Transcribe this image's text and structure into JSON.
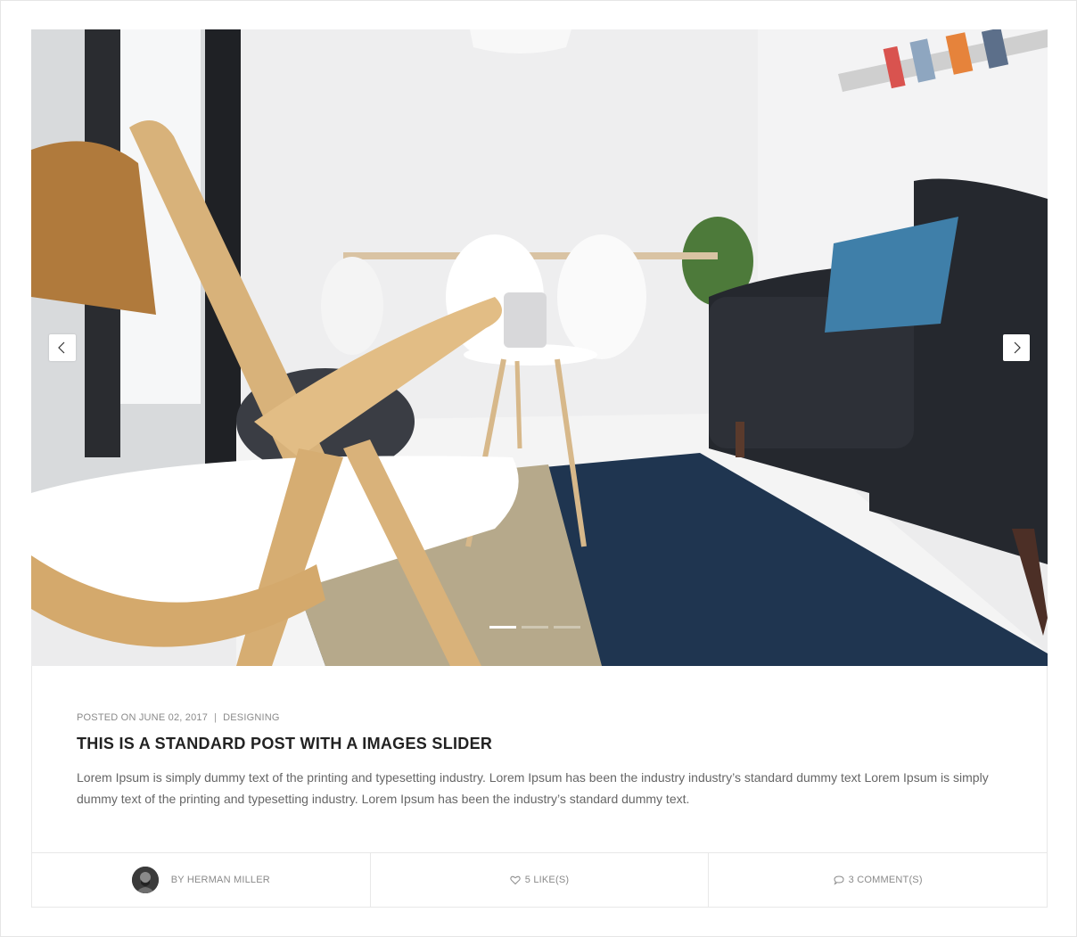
{
  "slider": {
    "prev_icon": "chevron-left-icon",
    "next_icon": "chevron-right-icon",
    "slides": 3,
    "active_slide": 1
  },
  "post": {
    "posted_on": "POSTED ON JUNE 02, 2017",
    "separator": "|",
    "category": "DESIGNING",
    "title": "THIS IS A STANDARD POST WITH A IMAGES SLIDER",
    "excerpt": "Lorem Ipsum is simply dummy text of the printing and typesetting industry. Lorem Ipsum has been the industry industry’s standard dummy text Lorem Ipsum is simply dummy text of the printing and typesetting industry. Lorem Ipsum has been the industry’s standard dummy text."
  },
  "footer": {
    "author": "BY HERMAN MILLER",
    "likes": "5 LIKE(S)",
    "comments": "3 COMMENT(S)",
    "like_icon": "heart-icon",
    "comment_icon": "speech-bubble-icon"
  },
  "colors": {
    "text_muted": "#8a8a8a",
    "title": "#222222",
    "border": "#e8e8e8"
  }
}
